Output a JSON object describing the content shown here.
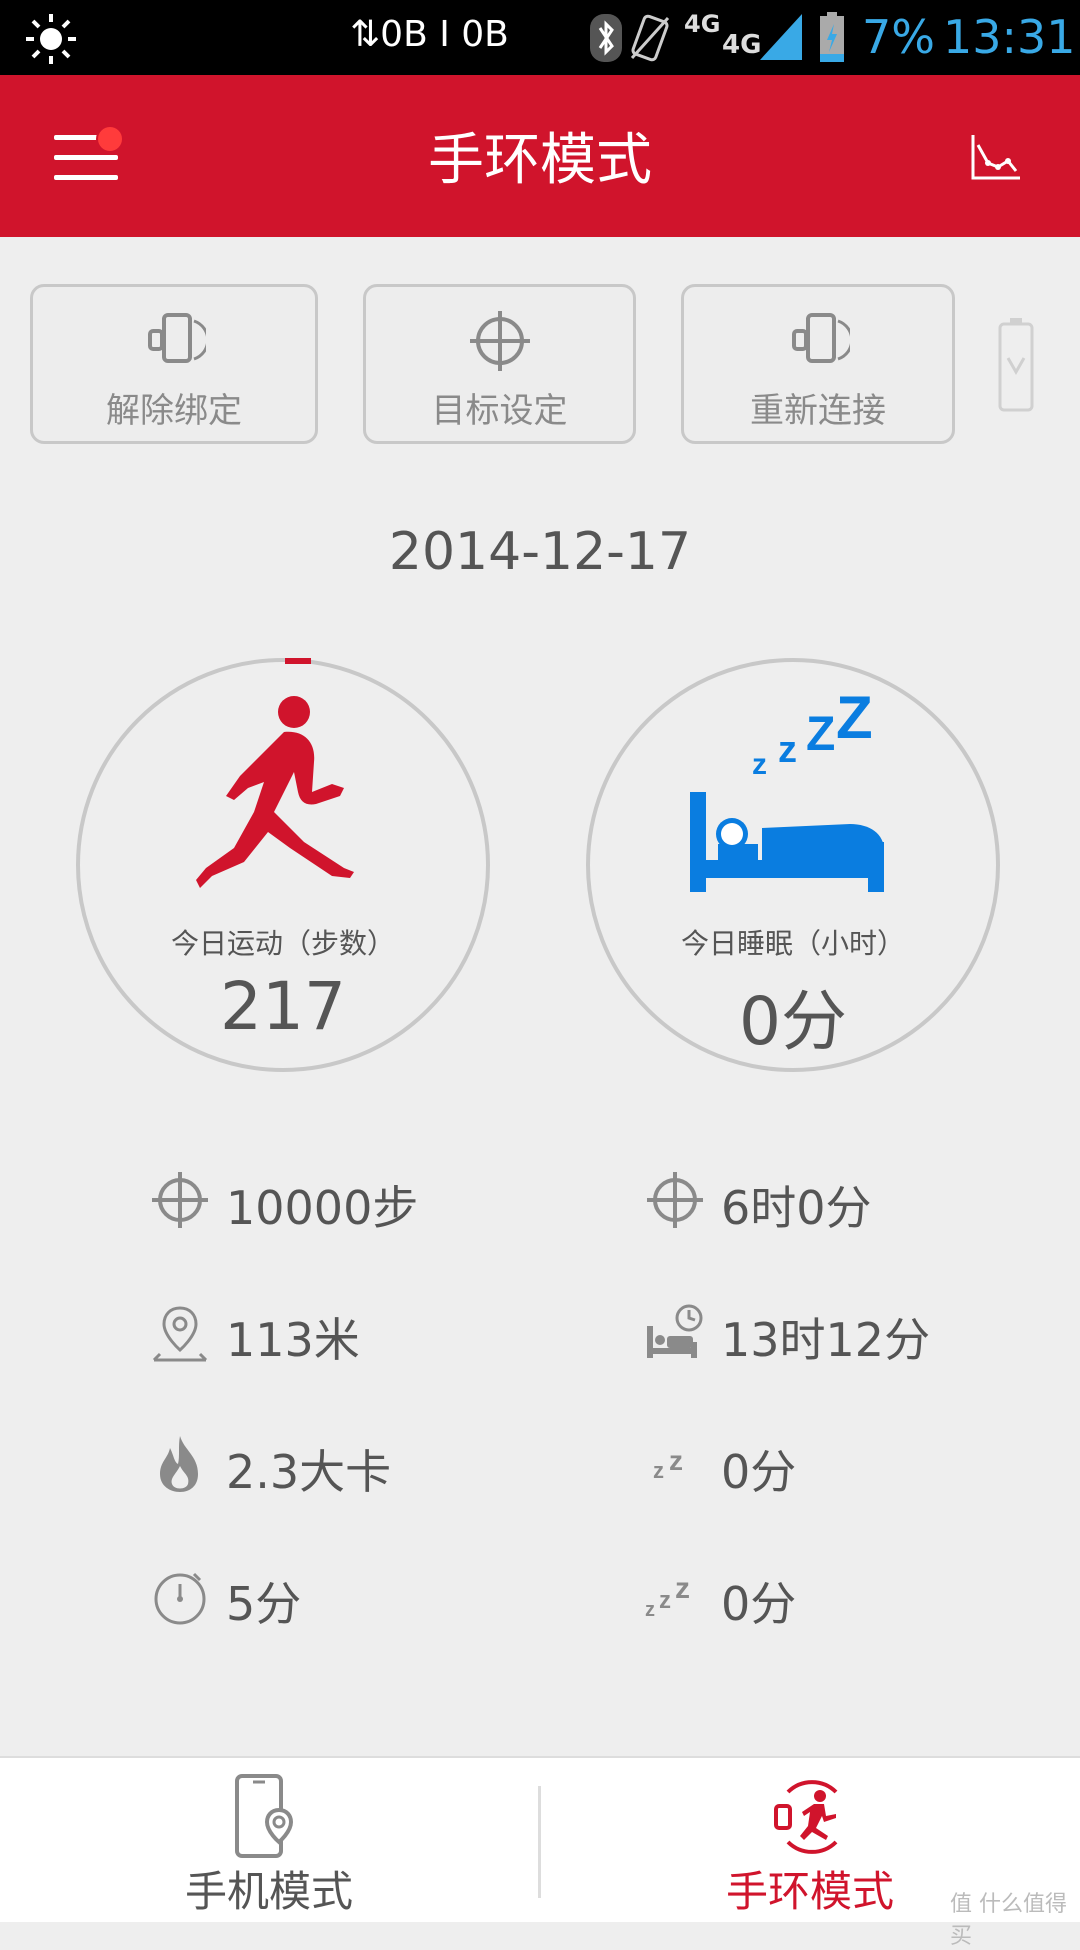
{
  "status_bar": {
    "net": "⇅0B I 0B",
    "g4_top": "4G",
    "g4": "4G",
    "battery_pct": "7%",
    "time": "13:31"
  },
  "header": {
    "title": "手环模式"
  },
  "actions": {
    "unbind": "解除绑定",
    "goal": "目标设定",
    "reconnect": "重新连接"
  },
  "date": "2014-12-17",
  "activity": {
    "label": "今日运动（步数）",
    "value": "217"
  },
  "sleep": {
    "label": "今日睡眠（小时）",
    "value": "0分"
  },
  "stats_left": {
    "goal_steps": "10000步",
    "distance": "113米",
    "calories": "2.3大卡",
    "duration": "5分"
  },
  "stats_right": {
    "goal_sleep": "6时0分",
    "bed_time": "13时12分",
    "light_sleep": "0分",
    "deep_sleep": "0分"
  },
  "bottom_nav": {
    "phone_mode": "手机模式",
    "band_mode": "手环模式"
  },
  "watermark": "值 什么值得买",
  "colors": {
    "brand_red": "#d0142c",
    "sleep_blue": "#0a7de0",
    "accent_blue": "#39a9e6"
  }
}
